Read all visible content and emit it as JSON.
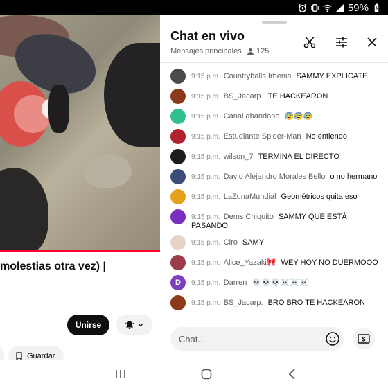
{
  "status_bar": {
    "battery_percent": "59%",
    "icons": [
      "alarm-icon",
      "vibrate-icon",
      "wifi-icon",
      "signal-icon",
      "battery-icon"
    ]
  },
  "video": {
    "progress": 1.0,
    "accent_color": "#ff0033"
  },
  "left": {
    "title": "molestias otra vez) |",
    "join_label": "Unirse",
    "save_label": "Guardar"
  },
  "chat": {
    "title": "Chat en vivo",
    "mode": "Mensajes principales",
    "viewer_count": "125",
    "messages": [
      {
        "time": "9:15 p.m.",
        "author": "Countryballs Irbenia",
        "text": "SAMMY EXPLICATE",
        "avatar_color": "#4a4a4a",
        "initial": ""
      },
      {
        "time": "9:15 p.m.",
        "author": "BS_Jacarp.",
        "text": "TE HACKEARON",
        "avatar_color": "#8b3a1a",
        "initial": ""
      },
      {
        "time": "9:15 p.m.",
        "author": "Canal abandono",
        "text": "😰😰😰",
        "avatar_color": "#2fbf8f",
        "initial": ""
      },
      {
        "time": "9:15 p.m.",
        "author": "Estudiante Spider-Man",
        "text": "No entiendo",
        "avatar_color": "#b2222e",
        "initial": ""
      },
      {
        "time": "9:15 p.m.",
        "author": "wilson_7",
        "text": "TERMINA EL DIRECTO",
        "avatar_color": "#1c1c1c",
        "initial": ""
      },
      {
        "time": "9:15 p.m.",
        "author": "David Alejandro Morales Bello",
        "text": "o no hermano",
        "avatar_color": "#3a4c7a",
        "initial": ""
      },
      {
        "time": "9:15 p.m.",
        "author": "LaZunaMundial",
        "text": "Geométricos quita eso",
        "avatar_color": "#e3a21a",
        "initial": ""
      },
      {
        "time": "9:15 p.m.",
        "author": "Dems Chiquito",
        "text": "SAMMY QUE ESTÁ PASANDO",
        "avatar_color": "#7b2fbe",
        "initial": ""
      },
      {
        "time": "9:15 p.m.",
        "author": "Ciro",
        "text": "SAMY",
        "avatar_color": "#e8d3c7",
        "initial": ""
      },
      {
        "time": "9:15 p.m.",
        "author": "Alice_Yazaki🎀",
        "text": "WEY HOY NO DUERMOOO",
        "avatar_color": "#9c3b4a",
        "initial": ""
      },
      {
        "time": "9:15 p.m.",
        "author": "Darren",
        "text": "💀💀💀☠️☠️☠️",
        "avatar_color": "#7e3fbf",
        "initial": "D"
      },
      {
        "time": "9:15 p.m.",
        "author": "BS_Jacarp.",
        "text": "BRO BRO TE HACKEARON",
        "avatar_color": "#8b3a1a",
        "initial": ""
      }
    ],
    "input_placeholder": "Chat..."
  },
  "nav_bar": {
    "icons": [
      "recents-icon",
      "home-icon",
      "back-icon"
    ]
  }
}
